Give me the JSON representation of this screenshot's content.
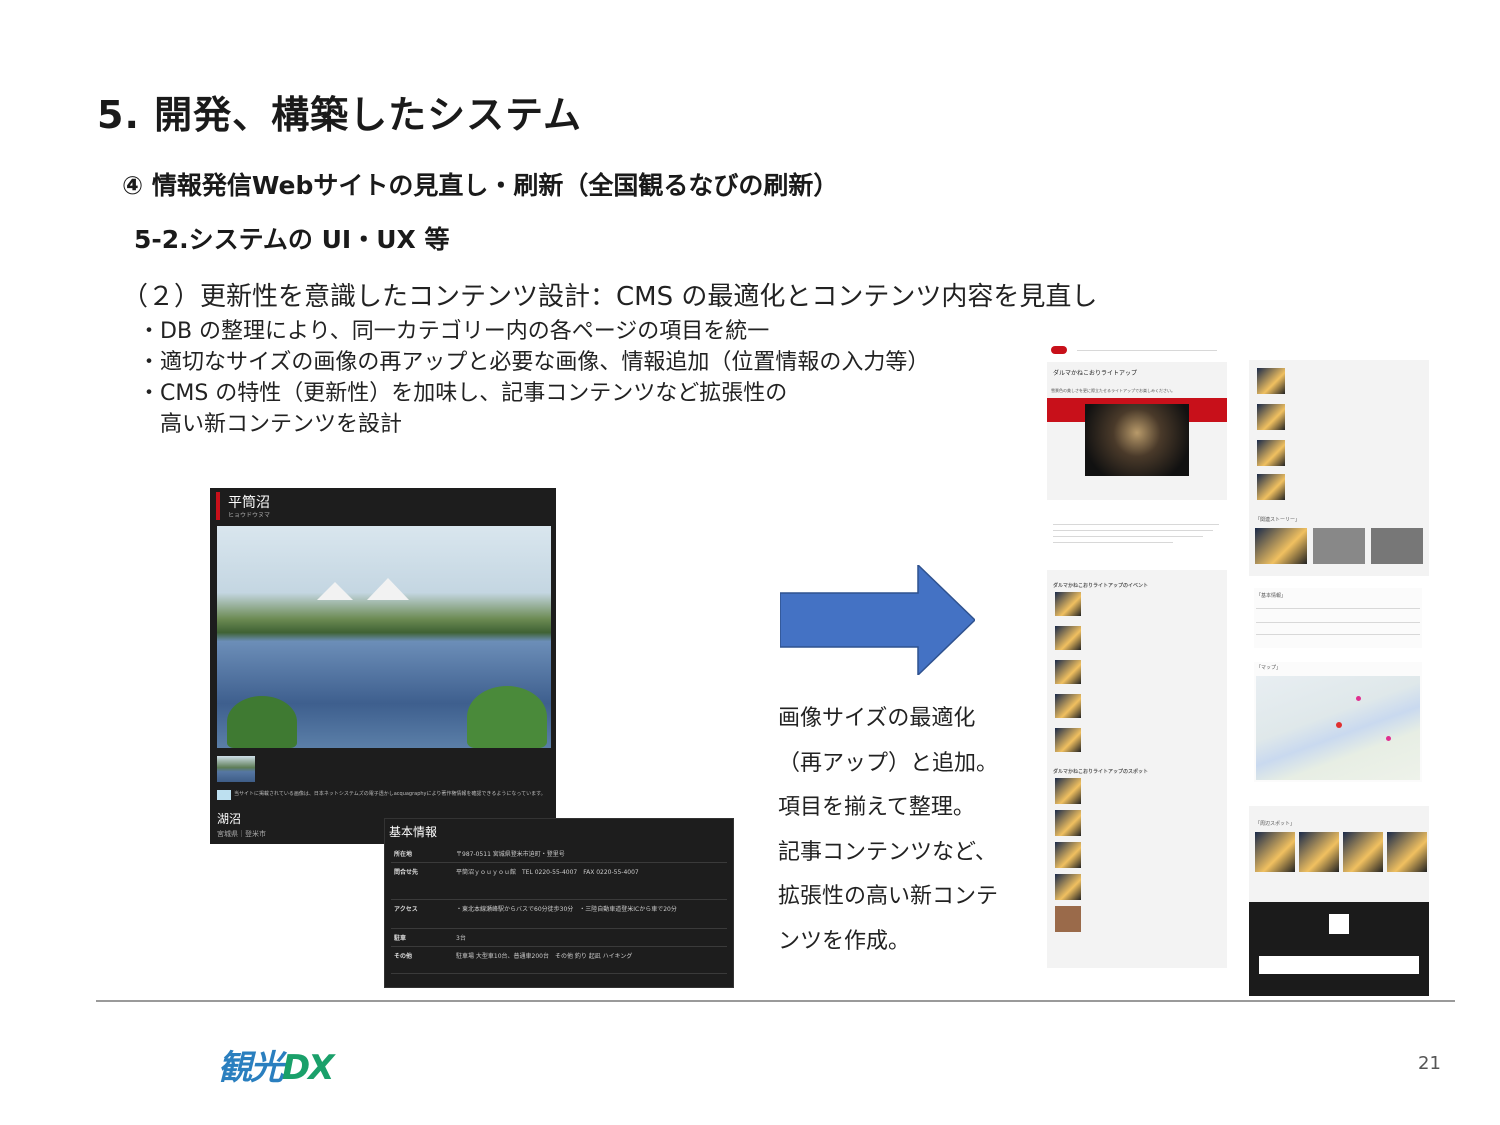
{
  "slide": {
    "title": "5. 開発、構築したシステム",
    "subtitle1": "④ 情報発信Webサイトの見直し・刷新（全国観るなびの刷新）",
    "subtitle2": "5-2.システムの UI・UX 等",
    "heading": "（２）更新性を意識したコンテンツ設計：CMS の最適化とコンテンツ内容を見直し",
    "bullets": [
      "・DB の整理により、同一カテゴリー内の各ページの項目を統一",
      "・適切なサイズの画像の再アップと必要な画像、情報追加（位置情報の入力等）",
      "・CMS の特性（更新性）を加味し、記事コンテンツなど拡張性の",
      "　高い新コンテンツを設計"
    ],
    "caption_lines": [
      "画像サイズの最適化",
      "（再アップ）と追加。",
      "項目を揃えて整理。",
      "記事コンテンツなど、",
      "拡張性の高い新コンテ",
      "ンツを作成。"
    ],
    "page_number": "21",
    "logo_text_1": "観光",
    "logo_text_2": "DX"
  },
  "old_site": {
    "place_name": "平筒沼",
    "place_kana": "ヒョウドウヌマ",
    "photo_note": "当サイトに掲載されている画像は、日本ネットシステムズの電子透かしacquagraphyにより著作権情報を確認できるようになっています。",
    "category": "湖沼",
    "prefecture": "宮城県｜登米市",
    "basic_info_title": "基本情報",
    "basic_info_rows": [
      {
        "key": "所在地",
        "value": "〒987-0511 宮城県登米市迫町・登里号"
      },
      {
        "key": "問合せ先",
        "value": "平筒沼ｙｏｕｙｏｕ館　TEL 0220-55-4007　FAX 0220-55-4007"
      },
      {
        "key": "アクセス",
        "value": "・東北本線瀬峰駅からバスで60分徒歩30分　・三陸自動車道登米ICから車で20分"
      },
      {
        "key": "駐車",
        "value": "3台"
      },
      {
        "key": "その他",
        "value": "駐車場 大型車10台、普通車200台　その他 釣り 起凪 ハイキング"
      }
    ]
  },
  "new_site": {
    "article_title": "ダルマかねこおりライトアップ",
    "article_lead": "雪景色の美しさを更に際立たせるライトアップでお楽しみください。",
    "section_events": "ダルマかねこおりライトアップのイベント",
    "section_spots": "ダルマかねこおりライトアップのスポット",
    "section_related": "「関連ストーリー」",
    "section_basic": "「基本情報」",
    "section_map": "「マップ」",
    "section_nearby": "「周辺スポット」"
  },
  "colors": {
    "accent_red": "#c8101a",
    "arrow_blue": "#4472c4",
    "logo_blue": "#2a7fbf",
    "logo_green": "#1aa06a"
  }
}
